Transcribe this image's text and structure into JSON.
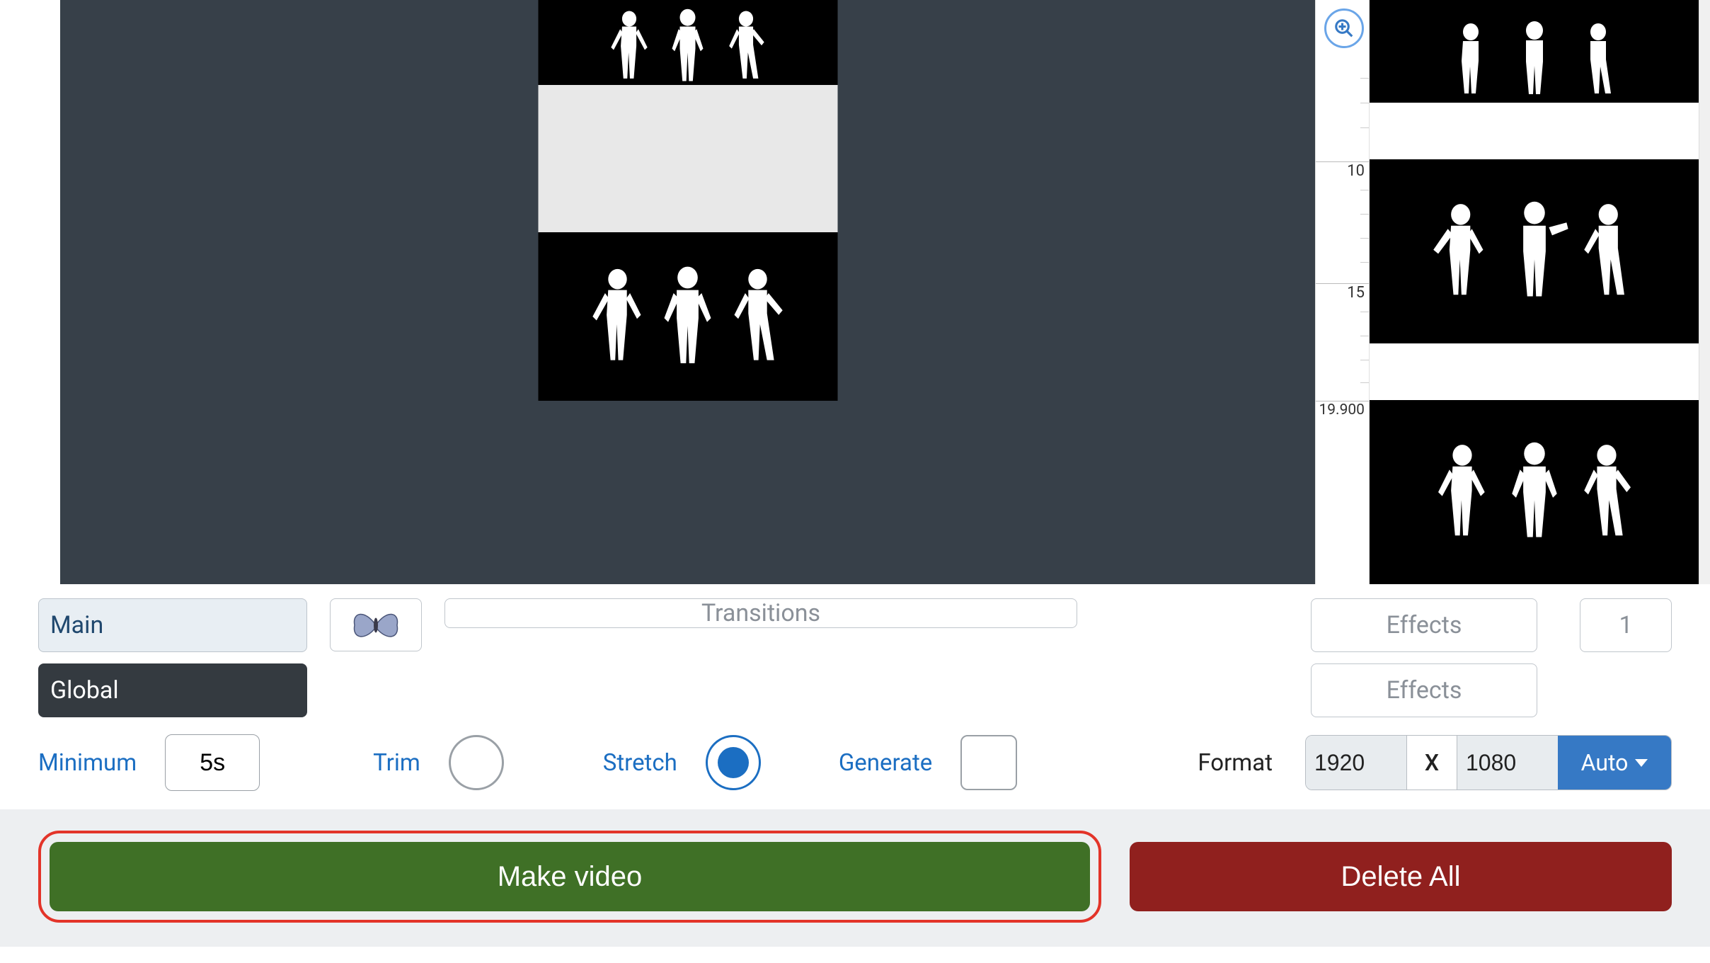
{
  "preview": {
    "frame_count": 3
  },
  "timeline": {
    "zoom_icon": "zoom-in",
    "markers": [
      "10",
      "15",
      "19.900"
    ]
  },
  "tabs": {
    "main": "Main",
    "global": "Global"
  },
  "transitions_label": "Transitions",
  "effects": {
    "label_top": "Effects",
    "count": "1",
    "label_bottom": "Effects"
  },
  "duration": {
    "minimum_label": "Minimum",
    "minimum_value": "5s",
    "trim_label": "Trim",
    "stretch_label": "Stretch",
    "generate_label": "Generate",
    "mode_selected": "stretch"
  },
  "format": {
    "label": "Format",
    "width": "1920",
    "separator": "X",
    "height": "1080",
    "auto_label": "Auto"
  },
  "actions": {
    "make_video": "Make video",
    "delete_all": "Delete All"
  },
  "colors": {
    "accent_blue": "#1b6ec2",
    "make_video_green": "#3f7026",
    "delete_red": "#90201e",
    "highlight_border": "#e33429",
    "dark_panel": "#374049",
    "auto_blue": "#3679c5"
  }
}
